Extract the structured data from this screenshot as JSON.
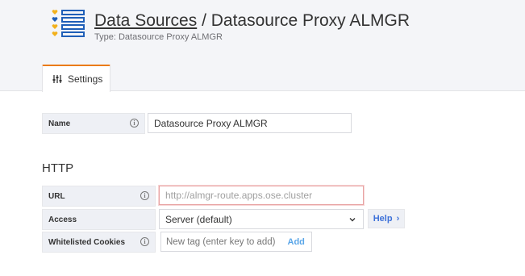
{
  "header": {
    "breadcrumb_link": "Data Sources",
    "separator": " / ",
    "title": "Datasource Proxy ALMGR",
    "subtitle": "Type: Datasource Proxy ALMGR",
    "logo_icon": "heart-list-icon"
  },
  "tabs": [
    {
      "label": "Settings",
      "icon": "sliders-icon",
      "accent": "#eb7b18"
    }
  ],
  "form": {
    "name": {
      "label": "Name",
      "value": "Datasource Proxy ALMGR"
    },
    "http_section_title": "HTTP",
    "url": {
      "label": "URL",
      "placeholder": "http://almgr-route.apps.ose.cluster"
    },
    "access": {
      "label": "Access",
      "value": "Server (default)",
      "help_label": "Help",
      "help_caret": "›"
    },
    "whitelisted_cookies": {
      "label": "Whitelisted Cookies",
      "placeholder": "New tag (enter key to add)",
      "add_label": "Add"
    }
  },
  "colors": {
    "accent": "#eb7b18",
    "link_blue": "#3d71d9",
    "add_blue": "#5aa6e8",
    "invalid_border": "#e8a3a3"
  }
}
